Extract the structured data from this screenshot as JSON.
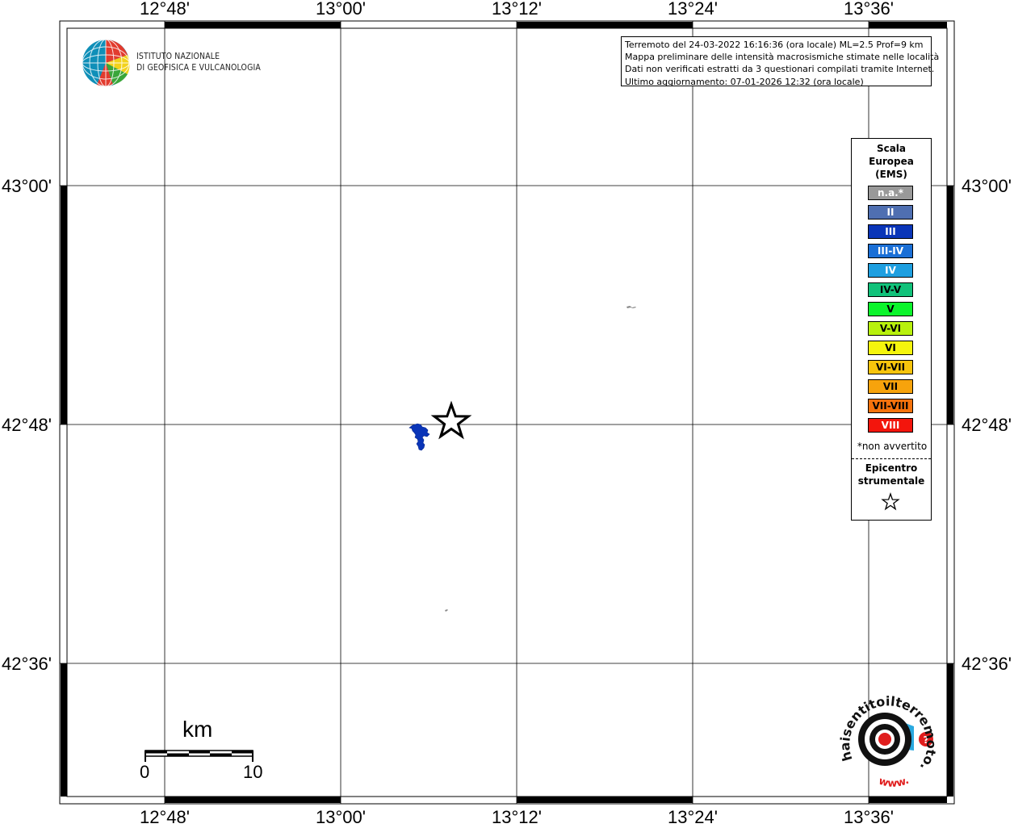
{
  "map": {
    "lon_ticks": [
      "12°48'",
      "13°00'",
      "13°12'",
      "13°24'",
      "13°36'"
    ],
    "lat_ticks": [
      "43°00'",
      "42°48'",
      "42°36'"
    ]
  },
  "logo": {
    "line1": "ISTITUTO NAZIONALE",
    "line2": "DI GEOFISICA E VULCANOLOGIA"
  },
  "info": {
    "line1": "Terremoto del 24-03-2022 16:16:36 (ora locale) ML=2.5 Prof=9 km",
    "line2": "Mappa preliminare delle intensità macrosismiche stimate nelle località",
    "line3": "Dati non verificati estratti da 3 questionari compilati tramite Internet.",
    "line4": "Ultimo aggiornamento: 07-01-2026 12:32 (ora locale)"
  },
  "legend": {
    "title_1": "Scala",
    "title_2": "Europea",
    "title_3": "(EMS)",
    "items": [
      {
        "label": "n.a.*",
        "color": "#999999",
        "text_color": "#ffffff"
      },
      {
        "label": "II",
        "color": "#4f6fb1",
        "text_color": "#ffffff"
      },
      {
        "label": "III",
        "color": "#0a35b8",
        "text_color": "#ffffff"
      },
      {
        "label": "III-IV",
        "color": "#1a6fd6",
        "text_color": "#ffffff"
      },
      {
        "label": "IV",
        "color": "#1e9fe0",
        "text_color": "#ffffff"
      },
      {
        "label": "IV-V",
        "color": "#11c27a",
        "text_color": "#000000"
      },
      {
        "label": "V",
        "color": "#0cf52c",
        "text_color": "#000000"
      },
      {
        "label": "V-VI",
        "color": "#b8f10d",
        "text_color": "#000000"
      },
      {
        "label": "VI",
        "color": "#f5f50d",
        "text_color": "#000000"
      },
      {
        "label": "VI-VII",
        "color": "#f7c40c",
        "text_color": "#000000"
      },
      {
        "label": "VII",
        "color": "#f7a30c",
        "text_color": "#000000"
      },
      {
        "label": "VII-VIII",
        "color": "#f5720c",
        "text_color": "#000000"
      },
      {
        "label": "VIII",
        "color": "#f3150c",
        "text_color": "#ffffff"
      }
    ],
    "note": "*non avvertito",
    "epicenter_1": "Epicentro",
    "epicenter_2": "strumentale"
  },
  "scale_bar": {
    "unit": "km",
    "start": "0",
    "end": "10"
  },
  "brand": {
    "name": "haisentitoilterremoto.it",
    "www": "www."
  }
}
